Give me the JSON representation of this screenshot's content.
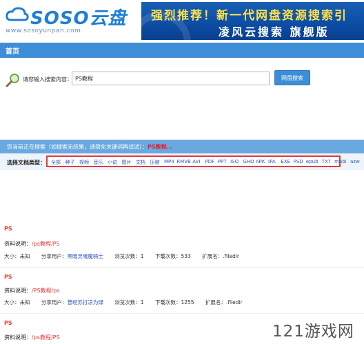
{
  "header": {
    "logo_text": "SOSO云盘",
    "logo_url": "www.sosoyunpan.com",
    "banner_line1": "强烈推荐！新一代网盘资源搜索引",
    "banner_line2": "凌风云搜索 旗舰版"
  },
  "nav": {
    "home_label": "首页"
  },
  "search": {
    "label": "请您输入搜索内容：",
    "value": "PS教程",
    "button_label": "网盘搜索"
  },
  "status": {
    "prefix": "您当前正在搜索（如搜索无结果，请简化关键词再试试）：",
    "term": "PS教程..."
  },
  "filetypes": {
    "label": "选择文档类型：",
    "items": [
      "全部",
      "种子",
      "视频",
      "音乐",
      "小说",
      "图片",
      "文档",
      "压缩",
      "MP4",
      "RMVB",
      "AVI",
      "PDF",
      "PPT",
      "ISO",
      "GHO",
      "APK",
      "IPA",
      "EXE",
      "PSD",
      "epub",
      "TXT",
      "mobi",
      "azw"
    ]
  },
  "results": [
    {
      "title": "PS",
      "desc_label": "资料说明：",
      "desc_value": "/ps教程/PS",
      "size": "大小：未知",
      "user_label": "分享用户：",
      "user": "黑暗灵魂魔骑士",
      "views": "浏览次数：1",
      "downloads": "下载次数：533",
      "ext": "扩展名：.filedir"
    },
    {
      "title": "PS",
      "desc_label": "资料说明：",
      "desc_value": "/PS教程/ps",
      "size": "大小：未知",
      "user_label": "分享用户：",
      "user": "曾经苏打凉为绿",
      "views": "浏览次数：1",
      "downloads": "下载次数：1255",
      "ext": "扩展名：.filedir"
    },
    {
      "title": "PS",
      "desc_label": "资料说明：",
      "desc_value": "/ps教程/PS"
    }
  ],
  "watermark": "121游戏网",
  "colors": {
    "nav": "#3d8ed6",
    "status": "#6aa9df",
    "accent_red": "#e23a3a",
    "link_blue": "#2a56b8"
  }
}
